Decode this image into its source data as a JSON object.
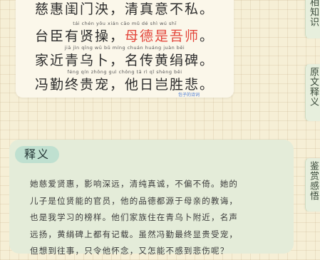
{
  "poem": {
    "lines": [
      {
        "pinyin": "",
        "text": "慈惠闺门泱，清真意不私。",
        "hl_start": -1,
        "hl_end": -1
      },
      {
        "pinyin": "tái  chén  yǒu  xián  cāo       mǔ   dé   shì   wú   shī",
        "text": "台臣有贤操，母德是吾师。",
        "hl_start": 6,
        "hl_end": 11
      },
      {
        "pinyin": "jiā   jìn  qīng  wū   bǔ       míng chuán huáng  juàn  bēi",
        "text": "家近青乌卜，名传黄绢碑。",
        "hl_start": -1,
        "hl_end": -1
      },
      {
        "pinyin": "féng  qín zhōng  guì  chǒng       tā   rì   qǐ  shèng  bēi",
        "text": "冯勤终贵宠，他日岂胜悲。",
        "hl_start": -1,
        "hl_end": -1
      }
    ],
    "watermark": "包子的诗词"
  },
  "tabs": [
    {
      "label": "相知识"
    },
    {
      "label": "原文释义"
    },
    {
      "label": "鉴赏感悟"
    }
  ],
  "explanation": {
    "title": "释义",
    "text": "她慈爱贤惠，影响深远，清纯真诚，不偏不倚。她的\n儿子是位贤能的官员，他的品德都源于母亲的教诲，\n也是我学习的榜样。他们家族住在青乌卜附近，名声\n远扬，黄绢碑上都有记载。虽然冯勤最终显贵受宠，\n但想到往事，只令他怀念，又怎能不感到悲伤呢？"
  },
  "colors": {
    "highlight": "#e3453b",
    "panel": "#e4ecd9",
    "title_pill": "#bfe0d0"
  }
}
